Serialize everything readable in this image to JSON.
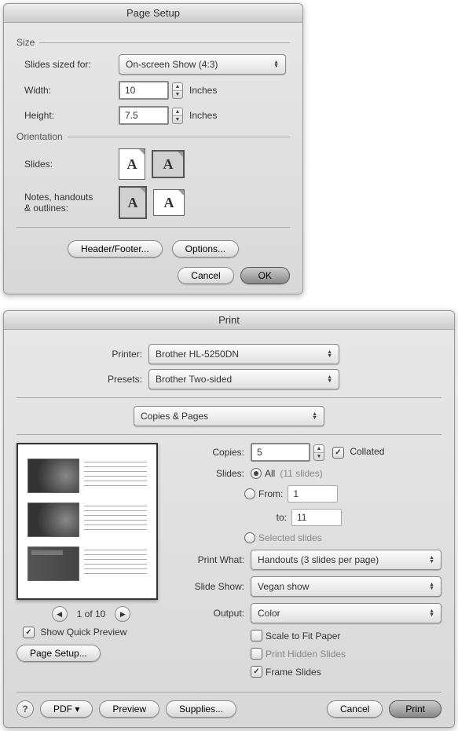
{
  "pageSetup": {
    "title": "Page Setup",
    "sizeLabel": "Size",
    "slidesSizedFor": {
      "label": "Slides sized for:",
      "value": "On-screen Show (4:3)"
    },
    "width": {
      "label": "Width:",
      "value": "10",
      "unit": "Inches"
    },
    "height": {
      "label": "Height:",
      "value": "7.5",
      "unit": "Inches"
    },
    "orientationLabel": "Orientation",
    "slidesOrient": {
      "label": "Slides:"
    },
    "notesOrient": {
      "label": "Notes, handouts\n& outlines:"
    },
    "headerFooterBtn": "Header/Footer...",
    "optionsBtn": "Options...",
    "cancelBtn": "Cancel",
    "okBtn": "OK"
  },
  "print": {
    "title": "Print",
    "printer": {
      "label": "Printer:",
      "value": "Brother HL-5250DN"
    },
    "presets": {
      "label": "Presets:",
      "value": "Brother Two-sided"
    },
    "panel": "Copies & Pages",
    "copies": {
      "label": "Copies:",
      "value": "5",
      "collated": "Collated"
    },
    "slides": {
      "label": "Slides:",
      "allLabel": "All",
      "allCount": "(11 slides)",
      "fromLabel": "From:",
      "fromVal": "1",
      "toLabel": "to:",
      "toVal": "11",
      "selectedLabel": "Selected slides"
    },
    "printWhat": {
      "label": "Print What:",
      "value": "Handouts (3 slides per page)"
    },
    "slideShow": {
      "label": "Slide Show:",
      "value": "Vegan show"
    },
    "output": {
      "label": "Output:",
      "value": "Color"
    },
    "scaleLabel": "Scale to Fit Paper",
    "hiddenLabel": "Print Hidden Slides",
    "frameLabel": "Frame Slides",
    "pager": "1 of 10",
    "quickPreview": "Show Quick Preview",
    "pageSetupBtn": "Page Setup...",
    "pdfBtn": "PDF ▾",
    "previewBtn": "Preview",
    "suppliesBtn": "Supplies...",
    "cancelBtn": "Cancel",
    "printBtn": "Print",
    "helpBtn": "?"
  }
}
